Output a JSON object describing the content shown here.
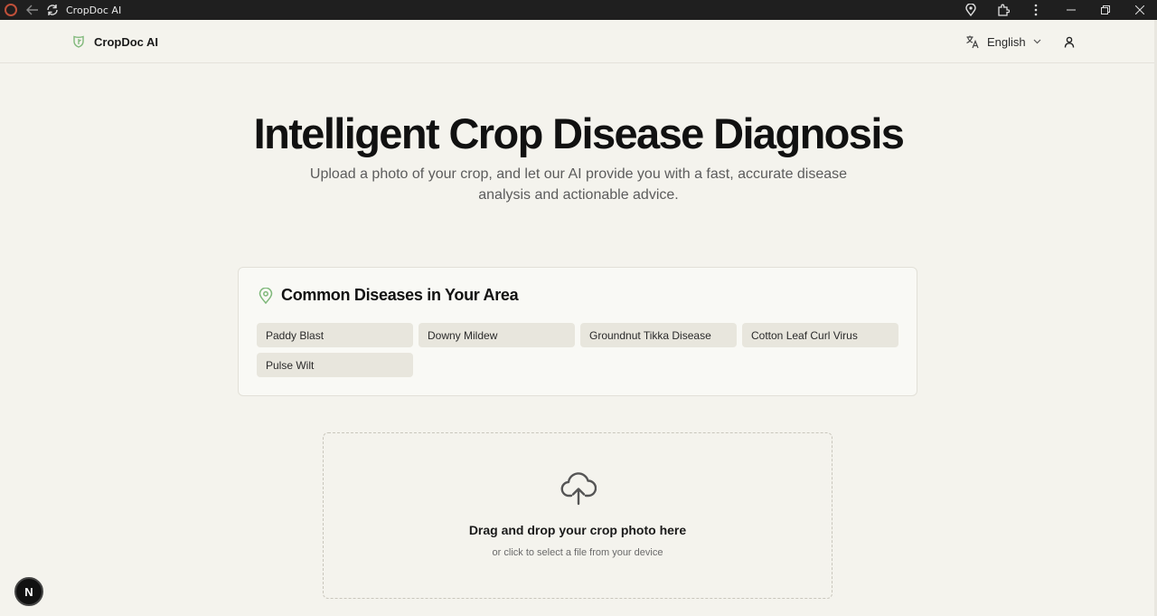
{
  "window": {
    "title": "CropDoc AI"
  },
  "header": {
    "brand": "CropDoc AI",
    "language": "English"
  },
  "hero": {
    "title": "Intelligent Crop Disease Diagnosis",
    "subtitle": "Upload a photo of your crop, and let our AI provide you with a fast, accurate disease analysis and actionable advice."
  },
  "diseases": {
    "title": "Common Diseases in Your Area",
    "items": [
      "Paddy Blast",
      "Downy Mildew",
      "Groundnut Tikka Disease",
      "Cotton Leaf Curl Virus",
      "Pulse Wilt"
    ]
  },
  "upload": {
    "title": "Drag and drop your crop photo here",
    "subtitle": "or click to select a file from your device"
  },
  "floating": {
    "label": "N"
  },
  "colors": {
    "accent": "#7fb87a",
    "background": "#f4f3ed",
    "titlebar": "#1f1f1f"
  }
}
